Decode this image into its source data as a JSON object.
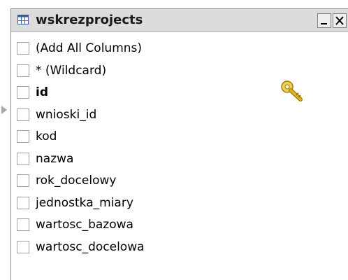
{
  "window": {
    "title": "wskrezprojects",
    "minimize_label": "_",
    "close_label": "X"
  },
  "columns": [
    {
      "label": "(Add All Columns)",
      "checked": false
    },
    {
      "label": "* (Wildcard)",
      "checked": false
    },
    {
      "label": "id",
      "checked": false,
      "primary_key": true
    },
    {
      "label": "wnioski_id",
      "checked": false
    },
    {
      "label": "kod",
      "checked": false
    },
    {
      "label": "nazwa",
      "checked": false
    },
    {
      "label": "rok_docelowy",
      "checked": false
    },
    {
      "label": "jednostka_miary",
      "checked": false
    },
    {
      "label": "wartosc_bazowa",
      "checked": false
    },
    {
      "label": "wartosc_docelowa",
      "checked": false
    }
  ],
  "icons": {
    "table": "table-icon",
    "key": "key-icon",
    "pointer": "row-pointer-icon"
  },
  "colors": {
    "title_bar": "#dcdcdc",
    "key_gold": "#e6b422"
  }
}
